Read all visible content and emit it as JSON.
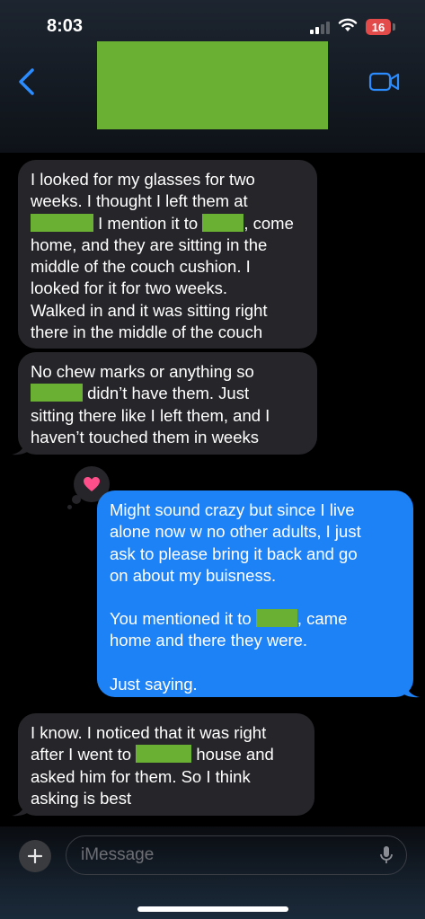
{
  "status": {
    "time": "8:03",
    "battery": "16"
  },
  "header": {
    "contact_name_redacted": true
  },
  "messages": {
    "m1": [
      "I looked for my glasses for two",
      "weeks. I thought I left them at",
      "I mention it to",
      ", come",
      "home, and they are sitting in the",
      "middle of the couch cushion. I",
      "looked for it for two weeks.",
      "Walked in and it was sitting right",
      "there in the middle of the couch"
    ],
    "m2": [
      "No chew marks or anything so",
      "didn’t have them. Just",
      "sitting there like I left them, and I",
      "haven’t touched them in weeks"
    ],
    "m3": [
      "Might sound crazy but since I live",
      "alone now w no other adults, I just",
      "ask to please bring it back and go",
      "on about my buisness.",
      "You mentioned it to",
      ", came",
      "home and there they were.",
      "Just saying."
    ],
    "m4": [
      "I know. I noticed that it was right",
      "after I went to",
      "house and",
      "asked him for them. So I think",
      "asking is best"
    ]
  },
  "tapback": {
    "icon": "heart-icon",
    "color": "#ff4f8b"
  },
  "composer": {
    "placeholder": "iMessage"
  },
  "colors": {
    "incoming": "#26262a",
    "outgoing": "#1e82f7",
    "accent": "#2a8cff",
    "redaction": "#6ab033"
  }
}
